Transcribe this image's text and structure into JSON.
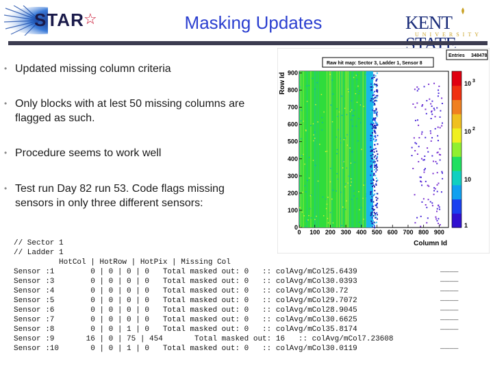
{
  "header": {
    "logo_text": "STAR",
    "title": "Masking Updates",
    "university_name": "KENT STATE",
    "university_sub": "UNIVERSITY"
  },
  "bullets": [
    {
      "text": "Updated missing column criteria"
    },
    {
      "text": "Only blocks with at lest 50 missing columns are flagged as such."
    },
    {
      "text": "Procedure seems to work well"
    },
    {
      "text": "Test run Day 82 run 53. Code flags missing sensors in  only three different sensors:"
    }
  ],
  "plot": {
    "title": "Raw hit map: Sector 3, Ladder 1, Sensor 8",
    "stats_label": "Entries",
    "stats_value": "348478",
    "xlabel": "Column Id",
    "ylabel": "Row Id",
    "xticks": [
      "0",
      "100",
      "200",
      "300",
      "400",
      "500",
      "600",
      "700",
      "800",
      "900"
    ],
    "yticks": [
      "0",
      "100",
      "200",
      "300",
      "400",
      "500",
      "600",
      "700",
      "800",
      "900"
    ],
    "zticks": [
      "1",
      "10",
      "10",
      "10"
    ],
    "zticks_exp": [
      "",
      "",
      "2",
      "3"
    ]
  },
  "code": {
    "lines": [
      "// Sector 1",
      "// Ladder 1",
      "          HotCol | HotRow | HotPix | Missing Col",
      "Sensor :1        0 | 0 | 0 | 0   Total masked out: 0   :: colAvg/mCol25.6439",
      "Sensor :3        0 | 0 | 0 | 0   Total masked out: 0   :: colAvg/mCol30.0393",
      "Sensor :4        0 | 0 | 0 | 0   Total masked out: 0   :: colAvg/mCol30.72",
      "Sensor :5        0 | 0 | 0 | 0   Total masked out: 0   :: colAvg/mCol29.7072",
      "Sensor :6        0 | 0 | 0 | 0   Total masked out: 0   :: colAvg/mCol28.9045",
      "Sensor :7        0 | 0 | 0 | 0   Total masked out: 0   :: colAvg/mCol30.6625",
      "Sensor :8        0 | 0 | 1 | 0   Total masked out: 0   :: colAvg/mCol35.8174",
      "Sensor :9       16 | 0 | 75 | 454       Total masked out: 16   :: colAvg/mCol7.23608",
      "Sensor :10       0 | 0 | 1 | 0   Total masked out: 0   :: colAvg/mCol30.0119"
    ],
    "dash_marker": "____"
  }
}
